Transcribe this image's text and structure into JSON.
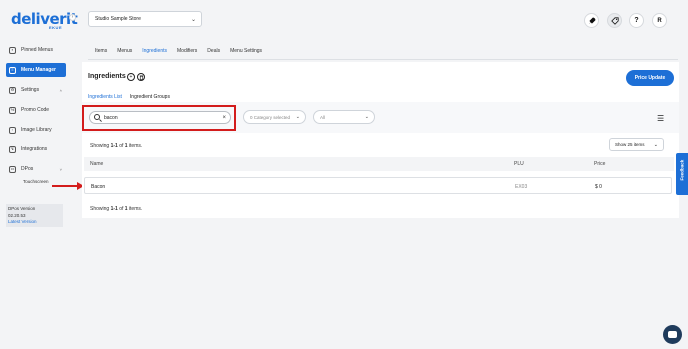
{
  "brand": {
    "logo": "deliverit",
    "logo_sub": "EKUE"
  },
  "sidebar": {
    "items": [
      {
        "label": "Pinned Menus",
        "icon": "pin-icon"
      },
      {
        "label": "Menu Manager",
        "icon": "menu-icon",
        "active": true
      },
      {
        "label": "Settings",
        "icon": "gear-icon"
      },
      {
        "label": "Promo Code",
        "icon": "promo-icon"
      },
      {
        "label": "Image Library",
        "icon": "image-icon"
      },
      {
        "label": "Integrations",
        "icon": "plug-icon"
      },
      {
        "label": "DPos",
        "icon": "dpos-icon"
      }
    ],
    "sub_item": "Touchscreen",
    "version_label": "DPos Version",
    "version_number": "02.20.53",
    "version_link": "Latest Version"
  },
  "header": {
    "store": "Studio Sample Store",
    "avatar_initial": "R",
    "help_symbol": "?"
  },
  "tabs": [
    "Items",
    "Menus",
    "Ingredients",
    "Modifiers",
    "Deals",
    "Menu Settings"
  ],
  "active_tab": "Ingredients",
  "page": {
    "title": "Ingredients",
    "price_update": "Price Update",
    "subtabs": [
      "Ingredients List",
      "Ingredient Groups"
    ],
    "search_value": "bacon",
    "category_filter": "0 Category selected",
    "status_filter": "All",
    "showing_prefix": "Showing ",
    "showing_range": "1-1",
    "showing_of": " of ",
    "showing_total": "1",
    "showing_suffix": " items.",
    "show_items": "Show 25 items"
  },
  "table": {
    "columns": [
      "Name",
      "PLU",
      "Price"
    ],
    "rows": [
      {
        "name": "Bacon",
        "plu": "EX03",
        "price": "$ 0"
      }
    ]
  },
  "feedback": "Feedback",
  "colors": {
    "brand": "#1d6fd6",
    "annotation": "#d31c1c"
  }
}
